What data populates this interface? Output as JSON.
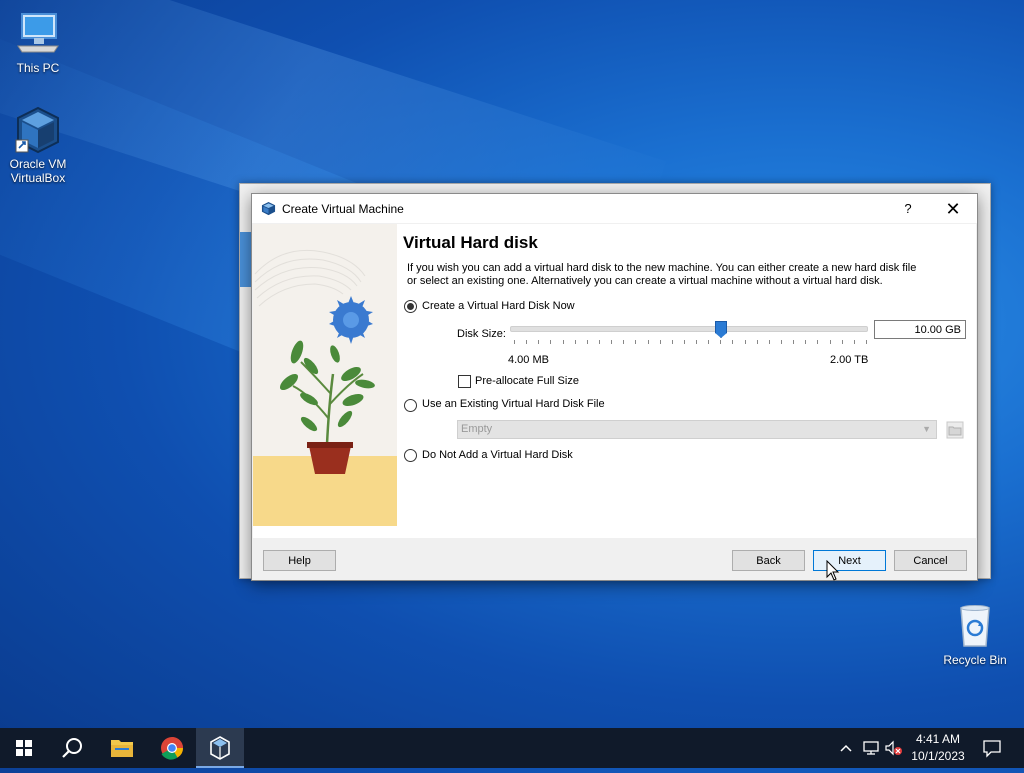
{
  "desktop": {
    "icons": [
      {
        "label": "This PC"
      },
      {
        "label_line1": "Oracle VM",
        "label_line2": "VirtualBox"
      },
      {
        "label": "Recycle Bin"
      }
    ]
  },
  "dialog": {
    "title": "Create Virtual Machine",
    "help_icon": "?",
    "close_icon": "✕",
    "heading": "Virtual Hard disk",
    "description": "If you wish you can add a virtual hard disk to the new machine. You can either create a new hard disk file or select an existing one. Alternatively you can create a virtual machine without a virtual hard disk.",
    "options": {
      "create_now": {
        "label": "Create a Virtual Hard Disk Now",
        "selected": true
      },
      "use_existing": {
        "label": "Use an Existing Virtual Hard Disk File",
        "selected": false
      },
      "do_not_add": {
        "label": "Do Not Add a Virtual Hard Disk",
        "selected": false
      }
    },
    "disk_size": {
      "label": "Disk Size:",
      "value": "10.00 GB",
      "min_label": "4.00 MB",
      "max_label": "2.00 TB",
      "slider_fraction": 0.59
    },
    "preallocate": {
      "label": "Pre-allocate Full Size",
      "checked": false
    },
    "existing_combo": {
      "value": "Empty",
      "enabled": false
    },
    "buttons": {
      "help": "Help",
      "back": "Back",
      "next": "Next",
      "cancel": "Cancel"
    }
  },
  "taskbar": {
    "time": "4:41 AM",
    "date": "10/1/2023"
  },
  "colors": {
    "accent": "#0078d7",
    "slider": "#2b7bd4",
    "taskbar": "#101a2a"
  }
}
